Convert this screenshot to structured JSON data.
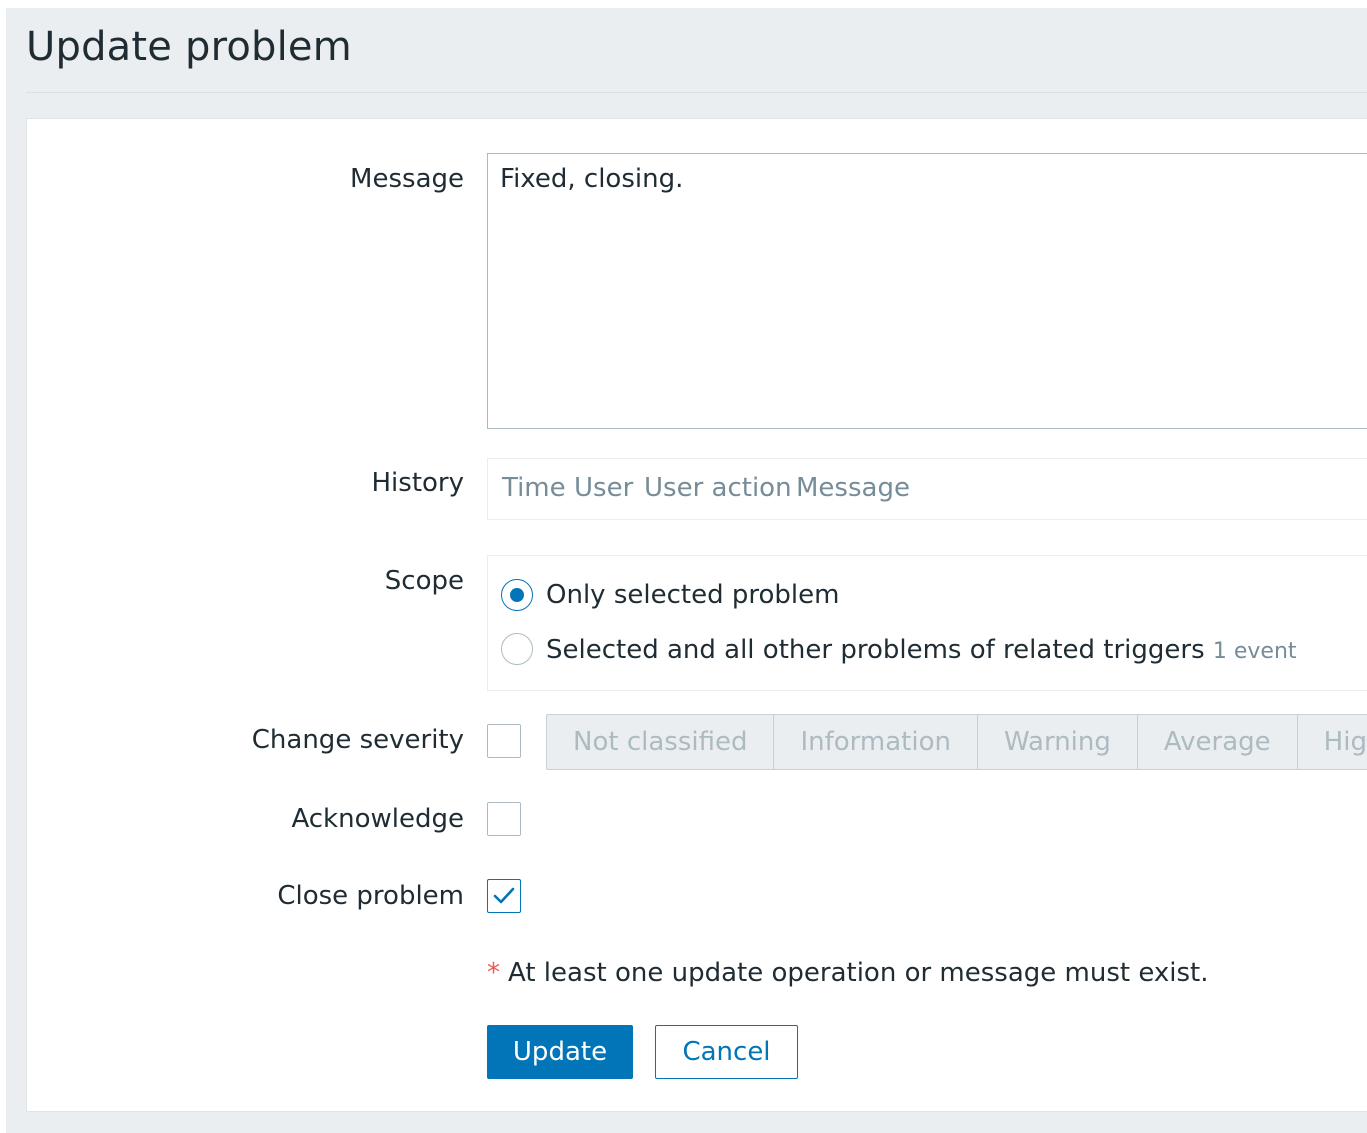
{
  "page": {
    "title": "Update problem"
  },
  "form": {
    "message": {
      "label": "Message",
      "value": "Fixed, closing."
    },
    "history": {
      "label": "History",
      "columns": [
        "Time",
        "User",
        "User action",
        "Message"
      ]
    },
    "scope": {
      "label": "Scope",
      "options": [
        {
          "label": "Only selected problem",
          "selected": true
        },
        {
          "label": "Selected and all other problems of related triggers",
          "hint": "1 event",
          "selected": false
        }
      ]
    },
    "change_severity": {
      "label": "Change severity",
      "checked": false,
      "levels": [
        "Not classified",
        "Information",
        "Warning",
        "Average",
        "High"
      ]
    },
    "acknowledge": {
      "label": "Acknowledge",
      "checked": false
    },
    "close_problem": {
      "label": "Close problem",
      "checked": true
    },
    "required_note": {
      "marker": "*",
      "text": "At least one update operation or message must exist."
    },
    "buttons": {
      "update": "Update",
      "cancel": "Cancel"
    }
  },
  "colors": {
    "accent": "#0275b8",
    "page_background": "#ebeef0",
    "required_marker": "#e45959",
    "muted_text": "#768d99"
  }
}
